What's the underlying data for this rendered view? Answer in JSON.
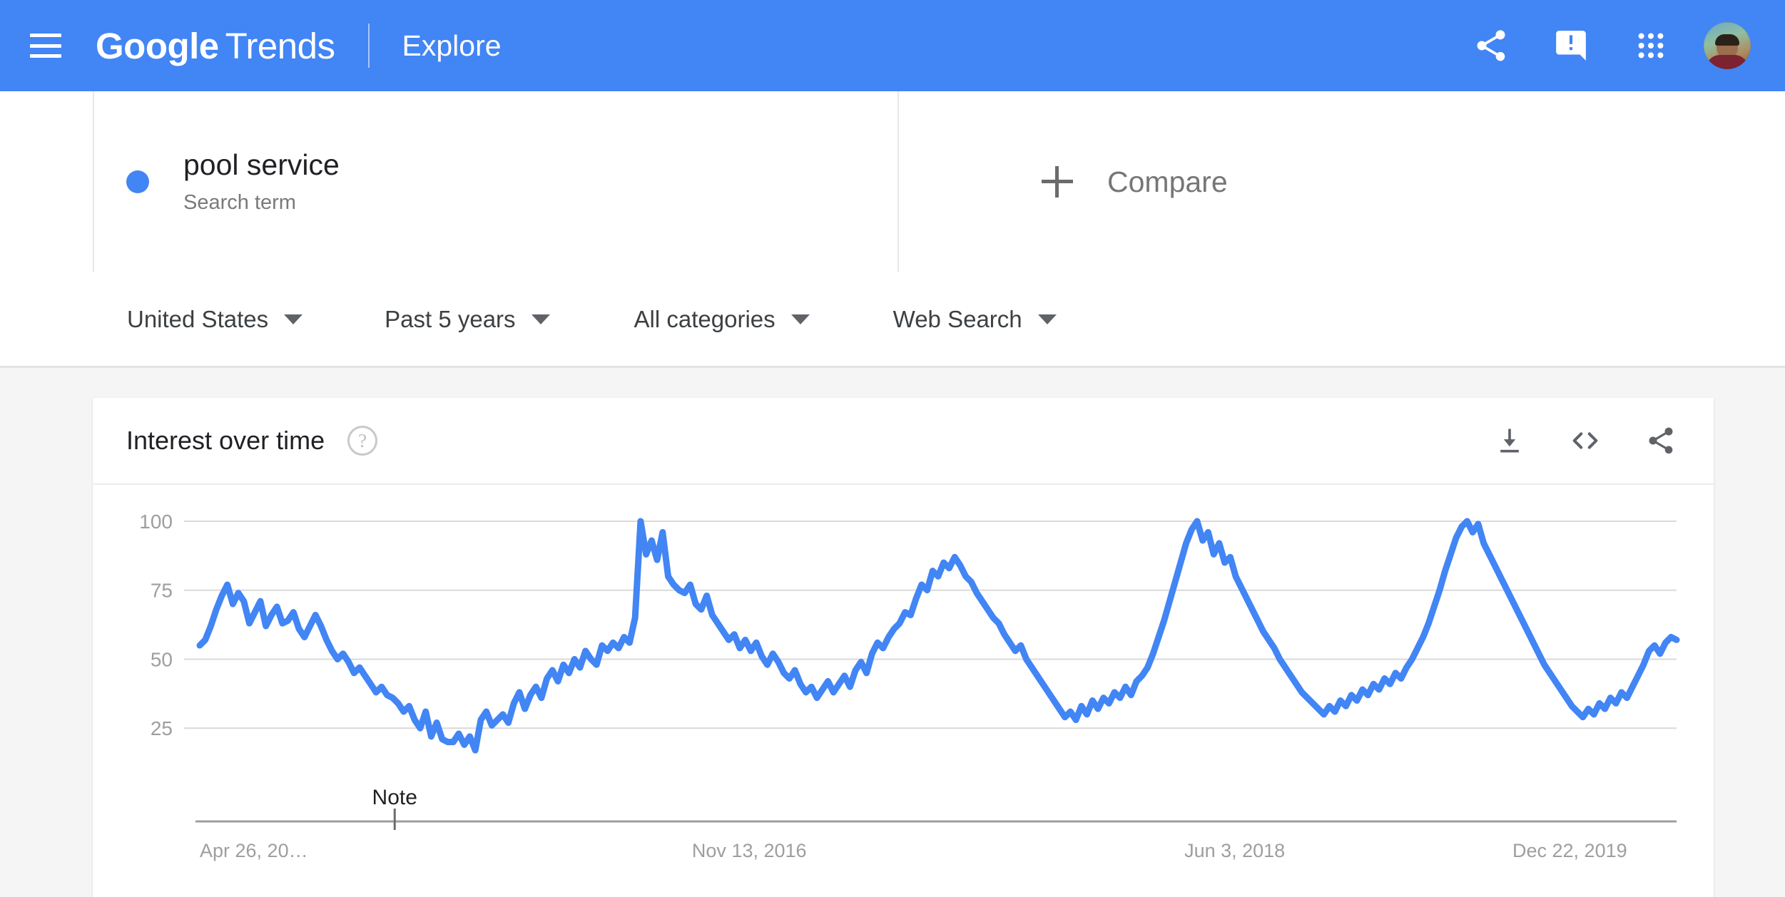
{
  "appbar": {
    "menu_icon": "hamburger-menu-icon",
    "brand_google": "Google",
    "brand_trends": "Trends",
    "section": "Explore",
    "share_icon": "share-icon",
    "feedback_icon": "feedback-icon",
    "apps_icon": "apps-grid-icon",
    "avatar_icon": "user-avatar",
    "background_color": "#4285f4"
  },
  "terms": {
    "term": {
      "title": "pool service",
      "subtitle": "Search term",
      "dot_color": "#4285f4"
    },
    "compare": {
      "plus_icon": "plus-icon",
      "label": "Compare"
    }
  },
  "filters": [
    {
      "label": "United States",
      "caret_icon": "chevron-down-icon"
    },
    {
      "label": "Past 5 years",
      "caret_icon": "chevron-down-icon"
    },
    {
      "label": "All categories",
      "caret_icon": "chevron-down-icon"
    },
    {
      "label": "Web Search",
      "caret_icon": "chevron-down-icon"
    }
  ],
  "card": {
    "title": "Interest over time",
    "help_icon": "help-circle-icon",
    "help_glyph": "?",
    "download_icon": "download-icon",
    "embed_icon": "embed-code-icon",
    "share_icon": "share-icon"
  },
  "chart_data": {
    "type": "line",
    "title": "Interest over time",
    "xlabel": "",
    "ylabel": "",
    "ylim": [
      0,
      108
    ],
    "yticks": [
      25,
      50,
      75,
      100
    ],
    "grid": true,
    "legend": "none",
    "line_color": "#4285f4",
    "series_name": "pool service",
    "region": "United States",
    "timeframe": "Past 5 years",
    "category": "All categories",
    "search_type": "Web Search",
    "xtick_labels": [
      "Apr 26, 20…",
      "Nov 13, 2016",
      "Jun 3, 2018",
      "Dec 22, 2019"
    ],
    "xtick_positions": [
      0,
      0.3333,
      0.6667,
      1.0
    ],
    "annotations": [
      {
        "label": "Note",
        "x_fraction": 0.132
      }
    ],
    "values": [
      55,
      57,
      62,
      68,
      73,
      77,
      70,
      74,
      71,
      63,
      67,
      71,
      62,
      66,
      69,
      63,
      64,
      67,
      61,
      58,
      62,
      66,
      62,
      57,
      53,
      50,
      52,
      49,
      45,
      47,
      44,
      41,
      38,
      40,
      37,
      36,
      34,
      31,
      33,
      28,
      25,
      31,
      22,
      27,
      21,
      20,
      20,
      23,
      19,
      22,
      17,
      28,
      31,
      26,
      28,
      30,
      27,
      34,
      38,
      32,
      37,
      40,
      36,
      43,
      46,
      42,
      48,
      45,
      50,
      47,
      53,
      50,
      48,
      55,
      53,
      56,
      54,
      58,
      56,
      65,
      100,
      88,
      93,
      86,
      96,
      80,
      77,
      75,
      74,
      77,
      70,
      68,
      73,
      66,
      63,
      60,
      57,
      59,
      54,
      57,
      53,
      56,
      51,
      48,
      52,
      49,
      45,
      43,
      46,
      41,
      38,
      40,
      36,
      39,
      42,
      38,
      41,
      44,
      40,
      46,
      49,
      45,
      52,
      56,
      54,
      58,
      61,
      63,
      67,
      66,
      72,
      77,
      75,
      82,
      80,
      85,
      83,
      87,
      84,
      80,
      78,
      74,
      71,
      68,
      65,
      63,
      59,
      56,
      53,
      55,
      50,
      47,
      44,
      41,
      38,
      35,
      32,
      29,
      31,
      28,
      33,
      30,
      35,
      32,
      36,
      34,
      38,
      36,
      40,
      37,
      42,
      44,
      47,
      52,
      58,
      64,
      71,
      78,
      85,
      92,
      97,
      100,
      93,
      96,
      88,
      92,
      85,
      87,
      80,
      76,
      72,
      68,
      64,
      60,
      57,
      54,
      50,
      47,
      44,
      41,
      38,
      36,
      34,
      32,
      30,
      33,
      31,
      35,
      33,
      37,
      35,
      39,
      37,
      41,
      39,
      43,
      41,
      45,
      43,
      47,
      50,
      54,
      58,
      63,
      69,
      75,
      82,
      88,
      94,
      98,
      100,
      96,
      99,
      92,
      88,
      84,
      80,
      76,
      72,
      68,
      64,
      60,
      56,
      52,
      48,
      45,
      42,
      39,
      36,
      33,
      31,
      29,
      32,
      30,
      34,
      32,
      36,
      34,
      38,
      36,
      40,
      44,
      48,
      53,
      55,
      52,
      56,
      58,
      57
    ]
  }
}
